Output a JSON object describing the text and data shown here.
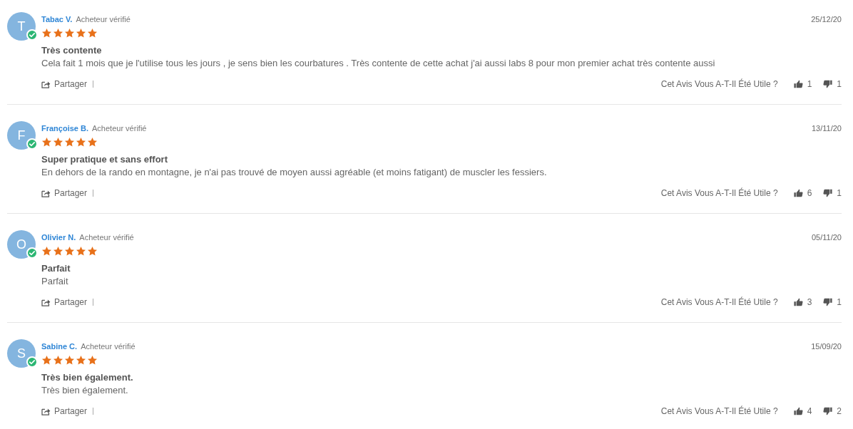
{
  "reviews": [
    {
      "initial": "T",
      "verified": true,
      "name": "Tabac V.",
      "badge": "Acheteur vérifié",
      "date": "25/12/20",
      "stars": 5,
      "title": "Très contente",
      "body": "Cela fait 1 mois que je l'utilise tous les jours , je sens bien les courbatures . Très contente de cette achat j'ai aussi labs 8 pour mon premier achat très contente aussi",
      "share": "Partager",
      "question": "Cet Avis Vous A-T-Il Été Utile ?",
      "likes": "1",
      "dislikes": "1"
    },
    {
      "initial": "F",
      "verified": true,
      "name": "Françoise B.",
      "badge": "Acheteur vérifié",
      "date": "13/11/20",
      "stars": 5,
      "title": "Super pratique et sans effort",
      "body": "En dehors de la rando en montagne, je n'ai pas trouvé de moyen aussi agréable (et moins fatigant) de muscler les fessiers.",
      "share": "Partager",
      "question": "Cet Avis Vous A-T-Il Été Utile ?",
      "likes": "6",
      "dislikes": "1"
    },
    {
      "initial": "O",
      "verified": true,
      "name": "Olivier N.",
      "badge": "Acheteur vérifié",
      "date": "05/11/20",
      "stars": 5,
      "title": "Parfait",
      "body": "Parfait",
      "share": "Partager",
      "question": "Cet Avis Vous A-T-Il Été Utile ?",
      "likes": "3",
      "dislikes": "1"
    },
    {
      "initial": "S",
      "verified": true,
      "name": "Sabine C.",
      "badge": "Acheteur vérifié",
      "date": "15/09/20",
      "stars": 5,
      "title": "Très bien également.",
      "body": "Très bien également.",
      "share": "Partager",
      "question": "Cet Avis Vous A-T-Il Été Utile ?",
      "likes": "4",
      "dislikes": "2"
    }
  ]
}
